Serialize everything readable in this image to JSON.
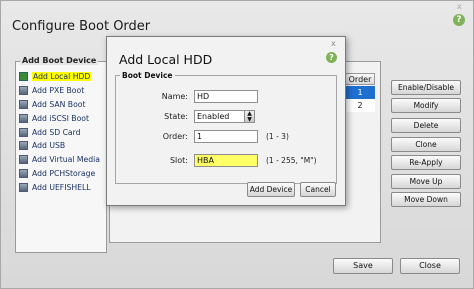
{
  "window": {
    "title": "Configure Boot Order",
    "help_glyph": "?",
    "close_glyph": "x"
  },
  "boot_device": {
    "legend": "Add Boot Device",
    "items": [
      {
        "label": "Add Local HDD",
        "icon": "hdd-icon",
        "selected": true
      },
      {
        "label": "Add PXE Boot",
        "icon": "network-boot-icon"
      },
      {
        "label": "Add SAN Boot",
        "icon": "san-boot-icon"
      },
      {
        "label": "Add iSCSI Boot",
        "icon": "iscsi-icon"
      },
      {
        "label": "Add SD Card",
        "icon": "sd-card-icon"
      },
      {
        "label": "Add USB",
        "icon": "usb-icon"
      },
      {
        "label": "Add Virtual Media",
        "icon": "virtual-media-icon"
      },
      {
        "label": "Add PCHStorage",
        "icon": "storage-icon"
      },
      {
        "label": "Add UEFISHELL",
        "icon": "uefi-shell-icon"
      }
    ]
  },
  "order_table": {
    "header": "Order",
    "rows": [
      "1",
      "2"
    ]
  },
  "side_buttons": {
    "enable_disable": "Enable/Disable",
    "modify": "Modify",
    "delete": "Delete",
    "clone": "Clone",
    "re_apply": "Re-Apply",
    "move_up": "Move Up",
    "move_down": "Move Down"
  },
  "footer": {
    "save": "Save",
    "close": "Close"
  },
  "modal": {
    "title": "Add Local HDD",
    "help_glyph": "?",
    "close_glyph": "x",
    "group_legend": "Boot Device",
    "name_label": "Name:",
    "name_value": "HD",
    "state_label": "State:",
    "state_value": "Enabled",
    "order_label": "Order:",
    "order_value": "1",
    "order_hint": "(1 - 3)",
    "slot_label": "Slot:",
    "slot_value": "HBA",
    "slot_hint": "(1 - 255, \"M\")",
    "add_button": "Add Device",
    "cancel_button": "Cancel"
  },
  "colors": {
    "selection_blue": "#1f6fd1",
    "highlight_yellow": "#ffff00",
    "help_green": "#7fb35a"
  }
}
